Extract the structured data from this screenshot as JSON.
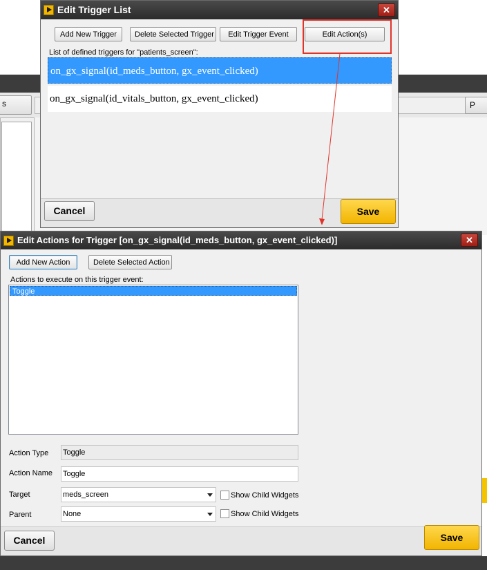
{
  "background": {
    "partial_button_label": "s",
    "partial_button_right_label": "P"
  },
  "trigger_dialog": {
    "title": "Edit Trigger List",
    "close_label": "✕",
    "toolbar": {
      "add_new": "Add New Trigger",
      "delete_selected": "Delete Selected Trigger",
      "edit_event": "Edit Trigger Event",
      "edit_actions": "Edit Action(s)"
    },
    "list_label": "List of defined triggers for \"patients_screen\":",
    "triggers": [
      "on_gx_signal(id_meds_button, gx_event_clicked)",
      "on_gx_signal(id_vitals_button, gx_event_clicked)"
    ],
    "selected_trigger_index": 0,
    "cancel": "Cancel",
    "save": "Save"
  },
  "actions_dialog": {
    "title": "Edit Actions for Trigger [on_gx_signal(id_meds_button, gx_event_clicked)]",
    "close_label": "✕",
    "toolbar": {
      "add_new": "Add New Action",
      "delete_selected": "Delete Selected Action"
    },
    "list_label": "Actions to execute on this trigger event:",
    "actions": [
      "Toggle"
    ],
    "form": {
      "action_type_label": "Action Type",
      "action_type_value": "Toggle",
      "action_name_label": "Action Name",
      "action_name_value": "Toggle",
      "target_label": "Target",
      "target_value": "meds_screen",
      "target_show_children": "Show Child Widgets",
      "parent_label": "Parent",
      "parent_value": "None",
      "parent_show_children": "Show Child Widgets"
    },
    "cancel": "Cancel",
    "save": "Save"
  },
  "colors": {
    "selection": "#3399ff",
    "save_button": "#f2b400",
    "highlight_box": "#e0342a",
    "titlebar": "#2b2b2b"
  }
}
